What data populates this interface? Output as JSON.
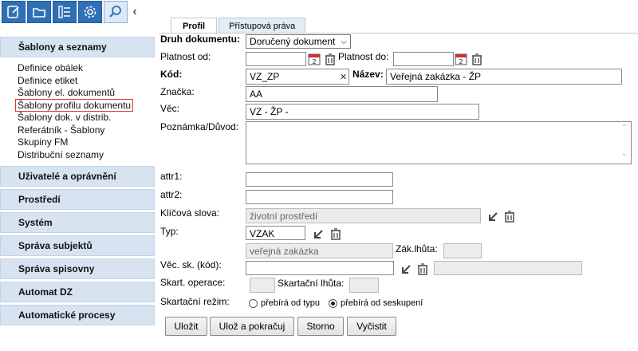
{
  "sidebar": {
    "sections": [
      {
        "label": "Šablony a seznamy",
        "items": [
          "Definice obálek",
          "Definice etiket",
          "Šablony el. dokumentů",
          "Šablony profilu dokumentu",
          "Šablony dok. v distrib.",
          "Referátník - Šablony",
          "Skupiny FM",
          "Distribuční seznamy"
        ]
      },
      {
        "label": "Uživatelé a oprávnění"
      },
      {
        "label": "Prostředí"
      },
      {
        "label": "Systém"
      },
      {
        "label": "Správa subjektů"
      },
      {
        "label": "Správa spisovny"
      },
      {
        "label": "Automat DZ"
      },
      {
        "label": "Automatické procesy"
      }
    ]
  },
  "tabs": [
    "Profil",
    "Přístupová práva"
  ],
  "form": {
    "druh_label": "Druh dokumentu:",
    "druh_value": "Doručený dokument",
    "platnost_od_label": "Platnost od:",
    "platnost_do_label": "Platnost do:",
    "kod_label": "Kód:",
    "kod_value": "VZ_ZP",
    "nazev_label": "Název:",
    "nazev_value": "Veřejná zakázka - ŽP",
    "znacka_label": "Značka:",
    "znacka_value": "AA",
    "vec_label": "Věc:",
    "vec_value": "VZ - ŽP -",
    "poznamka_label": "Poznámka/Důvod:",
    "attr1_label": "attr1:",
    "attr2_label": "attr2:",
    "klic_label": "Klíčová slova:",
    "klic_value": "životní prostředí",
    "typ_label": "Typ:",
    "typ_value": "VZAK",
    "typ_desc": "veřejná zakázka",
    "zak_lhuta_label": "Zák.lhůta:",
    "vec_sk_label": "Věc. sk. (kód):",
    "skart_op_label": "Skart. operace:",
    "skart_lhuta_label": "Skartační lhůta:",
    "skart_rezim_label": "Skartační režim:",
    "radio_typ": "přebírá od typu",
    "radio_seskupeni": "přebírá od seskupení",
    "calendar_day": "2"
  },
  "buttons": {
    "ulozit": "Uložit",
    "uloz_pokracuj": "Ulož a pokračuj",
    "storno": "Storno",
    "vycistit": "Vyčistit"
  },
  "colors": {
    "toolbar": "#2f6fb5",
    "section": "#d7e3f1",
    "highlight": "#dd3333"
  }
}
